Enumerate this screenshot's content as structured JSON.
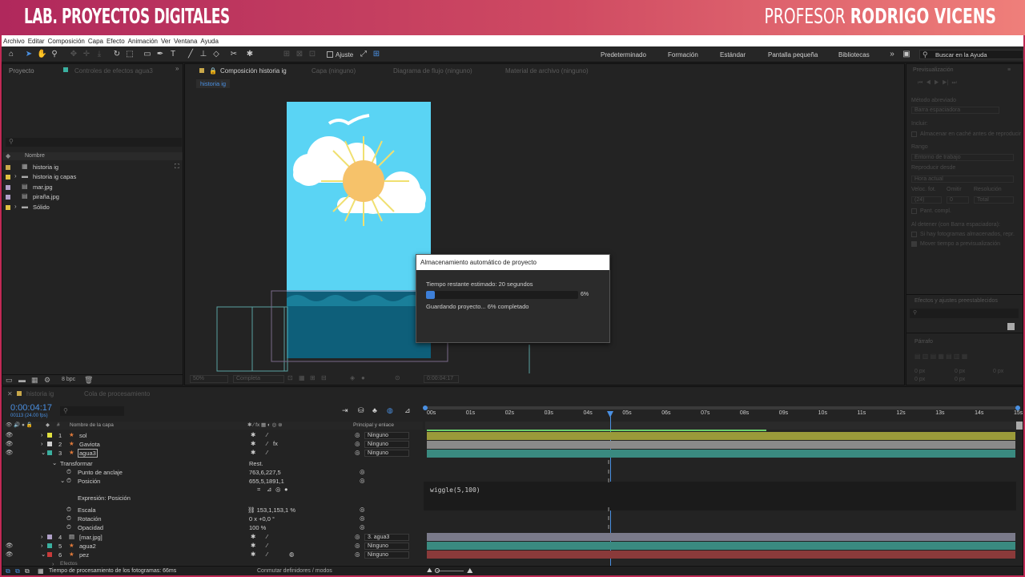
{
  "banner": {
    "left": "LAB. PROYECTOS DIGITALES",
    "right_prefix": "PROFESOR",
    "right_name": "RODRIGO VICENS"
  },
  "menu": [
    "Archivo",
    "Editar",
    "Composición",
    "Capa",
    "Efecto",
    "Animación",
    "Ver",
    "Ventana",
    "Ayuda"
  ],
  "toolbar": {
    "snap_label": "Ajuste",
    "workspaces": [
      "Predeterminado",
      "Formación",
      "Estándar",
      "Pantalla pequeña",
      "Bibliotecas"
    ],
    "search_placeholder": "Buscar en la Ayuda"
  },
  "project": {
    "tab": "Proyecto",
    "effects_tab": "Controles de efectos agua3",
    "col_name": "Nombre",
    "items": [
      {
        "name": "historia ig",
        "color": "#c9a84a"
      },
      {
        "name": "historia ig capas",
        "color": "#e0c040"
      },
      {
        "name": "mar.jpg",
        "color": "#b0a0c8"
      },
      {
        "name": "piraña.jpg",
        "color": "#b0a0c8"
      },
      {
        "name": "Sólido",
        "color": "#e0c040"
      }
    ],
    "bpc": "8 bpc"
  },
  "viewer": {
    "tabs": [
      "Composición historia ig",
      "Capa (ninguno)",
      "Diagrama de flujo (ninguno)",
      "Material de archivo (ninguno)"
    ],
    "crumb": "historia ig",
    "zoom": "50%",
    "quality": "Completa",
    "timecode": "0:00:04:17"
  },
  "dialog": {
    "title": "Almacenamiento automático de proyecto",
    "remaining": "Tiempo restante estimado: 20 segundos",
    "percent": "6%",
    "progress": 0.06,
    "status": "Guardando proyecto... 6% completado"
  },
  "right": {
    "preview": "Previsualización",
    "shortcut": "Método abreviado",
    "shortcut_val": "Barra espaciadora",
    "include": "Incluir:",
    "cache": "Almacenar en caché antes de reproducir",
    "range": "Rango",
    "range_val": "Entorno de trabajo",
    "play_from": "Reproducir desde",
    "play_from_val": "Hora actual",
    "fps": "Veloc. fot.",
    "skip": "Omitir",
    "res": "Resolución",
    "fps_val": "(24)",
    "skip_val": "0",
    "res_val": "Total",
    "fullscreen": "Pant. compl.",
    "on_stop": "Al detener (con Barra espaciadora):",
    "opt1": "Si hay fotogramas almacenados, repr.",
    "opt2": "Mover tiempo a previsualización",
    "effects_presets": "Efectos y ajustes preestablecidos",
    "paragraph": "Párrafo",
    "px": [
      "0 px",
      "0 px",
      "0 px",
      "0 px",
      "0 px"
    ]
  },
  "timeline": {
    "tab": "historia ig",
    "queue": "Cola de procesamiento",
    "timecode": "0:00:04:17",
    "frames": "00113 (24.00 fps)",
    "col_layer": "Nombre de la capa",
    "col_parent": "Principal y enlace",
    "ruler": [
      "00s",
      "01s",
      "02s",
      "03s",
      "04s",
      "05s",
      "06s",
      "07s",
      "08s",
      "09s",
      "10s",
      "11s",
      "12s",
      "13s",
      "14s",
      "15s"
    ],
    "layers": [
      {
        "num": "1",
        "name": "sol",
        "color": "#e0e040",
        "parent": "Ninguno",
        "track": "#9a9a3a"
      },
      {
        "num": "2",
        "name": "Gaviota",
        "color": "#d0d0d0",
        "parent": "Ninguno",
        "track": "#8a8a8a"
      },
      {
        "num": "3",
        "name": "agua3",
        "color": "#3ab0a0",
        "parent": "Ninguno",
        "track": "#3a8a80"
      }
    ],
    "transform": "Transformar",
    "reset": "Rest.",
    "props": [
      {
        "name": "Punto de anclaje",
        "value": "763,6,227,5"
      },
      {
        "name": "Posición",
        "value": "655,5,1891,1"
      }
    ],
    "expr_label": "Expresión: Posición",
    "expression": "wiggle(5,100)",
    "props2": [
      {
        "name": "Escala",
        "value": "153,1,153,1 %"
      },
      {
        "name": "Rotación",
        "value": "0 x +0,0 °"
      },
      {
        "name": "Opacidad",
        "value": "100 %"
      }
    ],
    "layers2": [
      {
        "num": "4",
        "name": "[mar.jpg]",
        "color": "#b0a0c8",
        "parent": "3. agua3",
        "track": "#7a7a8a"
      },
      {
        "num": "5",
        "name": "agua2",
        "color": "#3ab0a0",
        "parent": "Ninguno",
        "track": "#3a8a80"
      },
      {
        "num": "6",
        "name": "pez",
        "color": "#c83a3a",
        "parent": "Ninguno",
        "track": "#8a3a3a"
      }
    ],
    "effects": "Efectos",
    "footer_time": "Tiempo de procesamiento de los fotogramas: 66ms",
    "footer_toggle": "Conmutar definidores / modos"
  }
}
